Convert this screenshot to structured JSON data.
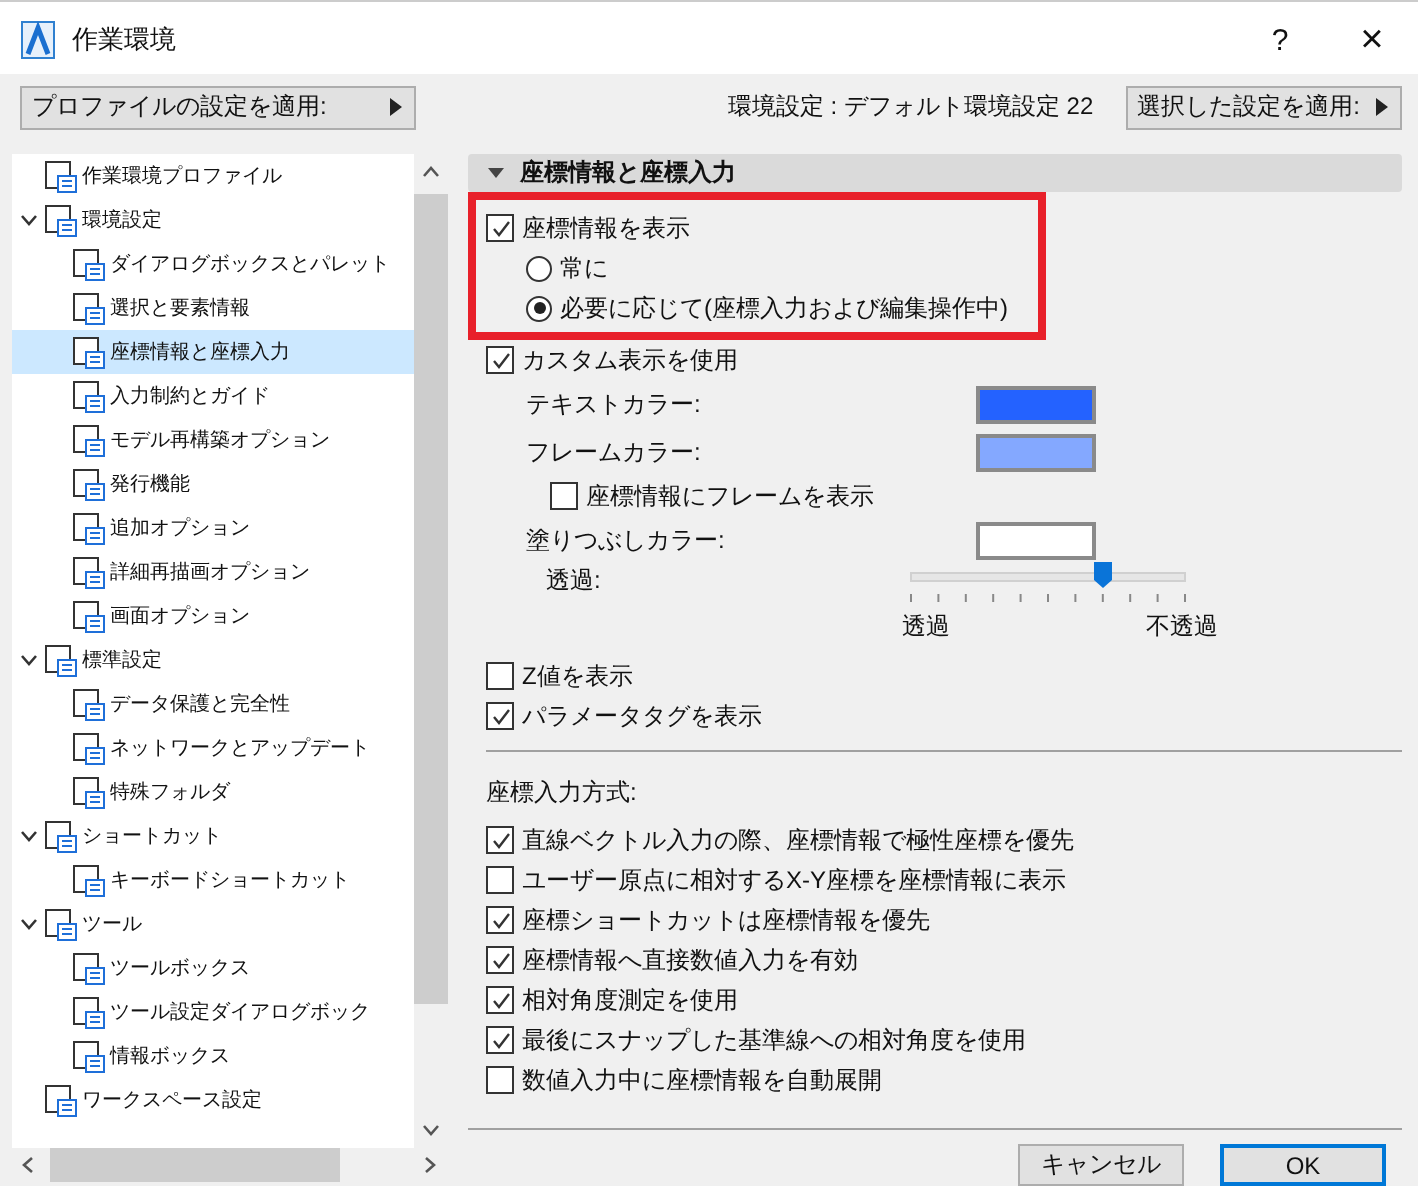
{
  "window": {
    "title": "作業環境",
    "help": "?",
    "close": "×"
  },
  "toolbar": {
    "profile_button": "プロファイルの設定を適用:",
    "current_profile": "環境設定 : デフォルト環境設定 22",
    "apply_button": "選択した設定を適用:"
  },
  "tree": [
    {
      "label": "作業環境プロファイル",
      "selected": false
    },
    {
      "label": "環境設定",
      "selected": false,
      "expanded": true,
      "children": [
        {
          "label": "ダイアログボックスとパレット",
          "selected": false
        },
        {
          "label": "選択と要素情報",
          "selected": false
        },
        {
          "label": "座標情報と座標入力",
          "selected": true
        },
        {
          "label": "入力制約とガイド",
          "selected": false
        },
        {
          "label": "モデル再構築オプション",
          "selected": false
        },
        {
          "label": "発行機能",
          "selected": false
        },
        {
          "label": "追加オプション",
          "selected": false
        },
        {
          "label": "詳細再描画オプション",
          "selected": false
        },
        {
          "label": "画面オプション",
          "selected": false
        }
      ]
    },
    {
      "label": "標準設定",
      "selected": false,
      "expanded": true,
      "children": [
        {
          "label": "データ保護と完全性",
          "selected": false
        },
        {
          "label": "ネットワークとアップデート",
          "selected": false
        },
        {
          "label": "特殊フォルダ",
          "selected": false
        }
      ]
    },
    {
      "label": "ショートカット",
      "selected": false,
      "expanded": true,
      "children": [
        {
          "label": "キーボードショートカット",
          "selected": false
        }
      ]
    },
    {
      "label": "ツール",
      "selected": false,
      "expanded": true,
      "children": [
        {
          "label": "ツールボックス",
          "selected": false
        },
        {
          "label": "ツール設定ダイアログボック",
          "selected": false
        },
        {
          "label": "情報ボックス",
          "selected": false
        }
      ]
    },
    {
      "label": "ワークスペース設定",
      "selected": false
    }
  ],
  "section": {
    "title": "座標情報と座標入力",
    "expanded": true
  },
  "settings": [
    {
      "kind": "checkbox",
      "label": "座標情報を表示",
      "checked": true,
      "highlighted": true,
      "children": [
        {
          "kind": "radio",
          "label": "常に",
          "selected": false
        },
        {
          "kind": "radio",
          "label": "必要に応じて(座標入力および編集操作中)",
          "selected": true
        }
      ]
    },
    {
      "kind": "checkbox",
      "label": "カスタム表示を使用",
      "checked": true,
      "children": [
        {
          "kind": "color",
          "label": "テキストカラー:",
          "color": "#2462ff"
        },
        {
          "kind": "color",
          "label": "フレームカラー:",
          "color": "#84a8ff"
        },
        {
          "kind": "checkbox",
          "label": "座標情報にフレームを表示",
          "checked": false
        },
        {
          "kind": "color",
          "label": "塗りつぶしカラー:",
          "color": "#ffffff"
        },
        {
          "kind": "slider",
          "label": "透過:",
          "level": 0.7,
          "min_label": "透過",
          "max_label": "不透過"
        }
      ]
    },
    {
      "kind": "checkbox",
      "label": "Z値を表示",
      "checked": false
    },
    {
      "kind": "checkbox",
      "label": "パラメータタグを表示",
      "checked": true
    },
    {
      "kind": "divider"
    },
    {
      "kind": "heading",
      "label": "座標入力方式:"
    },
    {
      "kind": "checkbox",
      "label": "直線ベクトル入力の際、座標情報で極性座標を優先",
      "checked": true
    },
    {
      "kind": "checkbox",
      "label": "ユーザー原点に相対するX-Y座標を座標情報に表示",
      "checked": false
    },
    {
      "kind": "checkbox",
      "label": "座標ショートカットは座標情報を優先",
      "checked": true
    },
    {
      "kind": "checkbox",
      "label": "座標情報へ直接数値入力を有効",
      "checked": true
    },
    {
      "kind": "checkbox",
      "label": "相対角度測定を使用",
      "checked": true
    },
    {
      "kind": "checkbox",
      "label": "最後にスナップした基準線への相対角度を使用",
      "checked": true
    },
    {
      "kind": "checkbox",
      "label": "数値入力中に座標情報を自動展開",
      "checked": false
    }
  ],
  "buttons": [
    {
      "label": "キャンセル",
      "default": false
    },
    {
      "label": "OK",
      "default": true
    }
  ]
}
